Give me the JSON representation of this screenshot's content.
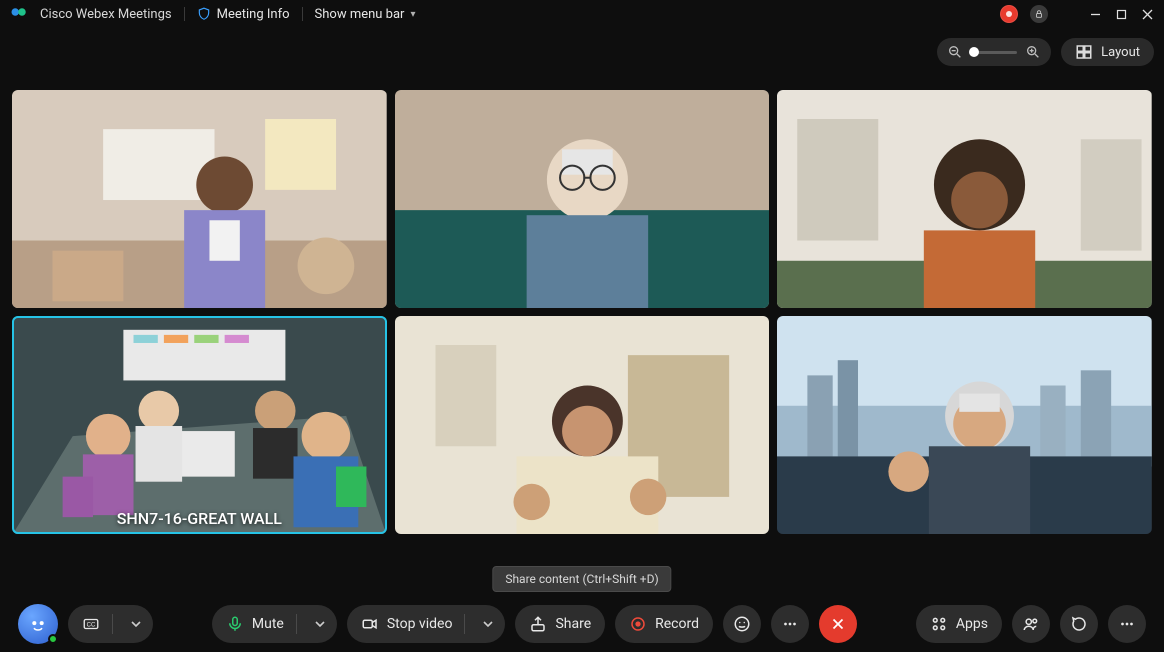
{
  "header": {
    "app_title": "Cisco Webex Meetings",
    "meeting_info_label": "Meeting Info",
    "menu_bar_label": "Show menu bar"
  },
  "layout": {
    "button_label": "Layout"
  },
  "tooltip": {
    "share_hint": "Share content (Ctrl+Shift +D)"
  },
  "tiles": [
    {
      "label": ""
    },
    {
      "label": ""
    },
    {
      "label": ""
    },
    {
      "label": "SHN7-16-GREAT WALL",
      "active": true
    },
    {
      "label": ""
    },
    {
      "label": ""
    }
  ],
  "bottom": {
    "mute_label": "Mute",
    "stop_video_label": "Stop video",
    "share_label": "Share",
    "record_label": "Record",
    "apps_label": "Apps"
  }
}
